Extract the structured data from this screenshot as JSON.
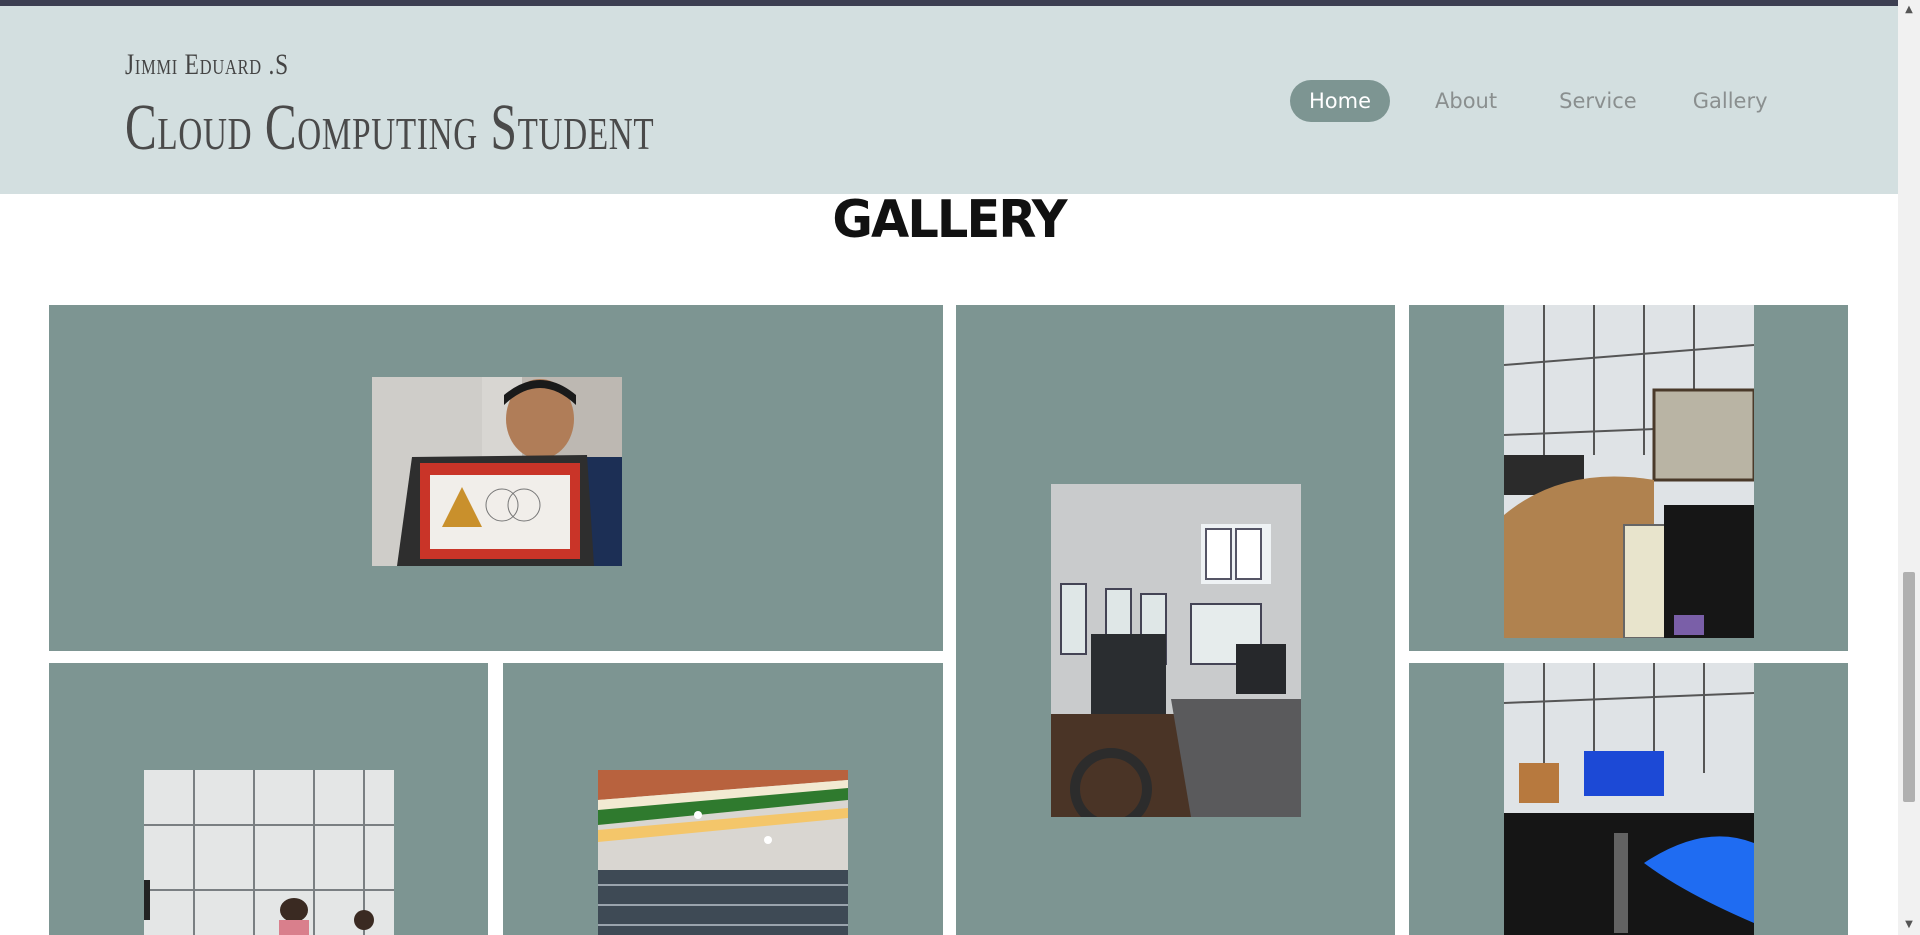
{
  "brand": {
    "subtitle": "Jimmi Eduard .S",
    "title": "Cloud Computing Student"
  },
  "nav": {
    "items": [
      {
        "label": "Home",
        "active": true
      },
      {
        "label": "About",
        "active": false
      },
      {
        "label": "Service",
        "active": false
      },
      {
        "label": "Gallery",
        "active": false
      }
    ]
  },
  "gallery": {
    "heading": "GALLERY"
  },
  "colors": {
    "header_bg": "#d3dfe0",
    "tile_bg": "#7d9592",
    "nav_active_bg": "#7d9592"
  }
}
